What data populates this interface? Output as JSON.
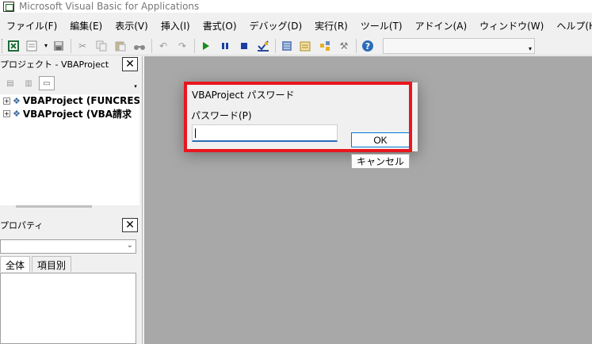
{
  "window": {
    "title": "Microsoft Visual Basic for Applications"
  },
  "menu": [
    "ファイル(F)",
    "編集(E)",
    "表示(V)",
    "挿入(I)",
    "書式(O)",
    "デバッグ(D)",
    "実行(R)",
    "ツール(T)",
    "アドイン(A)",
    "ウィンドウ(W)",
    "ヘルプ(H)"
  ],
  "toolbar": {
    "icons": [
      "excel-icon",
      "insert-module-icon",
      "save-icon",
      "cut-icon",
      "copy-icon",
      "paste-icon",
      "find-icon",
      "undo-icon",
      "redo-icon",
      "run-icon",
      "pause-icon",
      "stop-icon",
      "design-mode-icon",
      "project-explorer-icon",
      "properties-icon",
      "object-browser-icon",
      "toolbox-icon",
      "help-icon"
    ],
    "colors": {
      "run": "#1a8a1a",
      "stop": "#1a3fa0",
      "help": "#2a6cb8"
    }
  },
  "project_pane": {
    "title": "プロジェクト - VBAProject",
    "items": [
      "VBAProject (FUNCRES",
      "VBAProject (VBA請求"
    ]
  },
  "properties_pane": {
    "title": "プロパティ",
    "tabs": [
      "全体",
      "項目別"
    ]
  },
  "dialog": {
    "title": "VBAProject パスワード",
    "password_label": "パスワード(P)",
    "password_value": "",
    "ok_label": "OK",
    "cancel_label": "キャンセル"
  },
  "accent": {
    "highlight": "#e8161e",
    "focus": "#0078d7"
  }
}
